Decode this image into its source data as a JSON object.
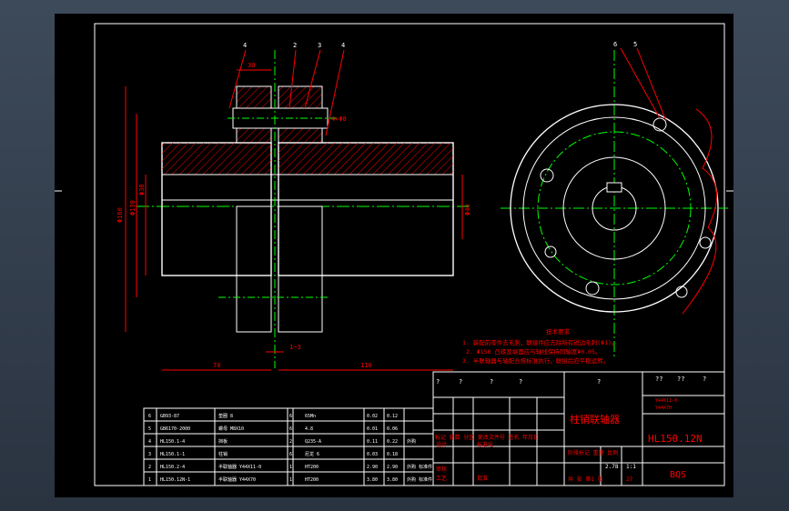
{
  "title_block": {
    "drawing_name": "柱销联轴器",
    "drawing_number": "HL150.12N",
    "school": "BQS",
    "top_qmarks": [
      "?",
      "?",
      "?",
      "?",
      "?",
      "??",
      "??",
      "?"
    ],
    "spec_line1": "Y44X11-0",
    "spec_line2": "Y44X70",
    "rev_header": "标记 处数 分区 更改文件号 签名 年月日",
    "designer": "设计",
    "standardize": "标准化",
    "check": "审核",
    "process": "工艺",
    "approve": "批准",
    "stage_header": "阶段标记 重量 比例",
    "weight": "2.78",
    "scale": "1:1",
    "sheets": "共 张 第1 张",
    "sheet_no": "27"
  },
  "tech_requirements": {
    "title": "技术要求",
    "lines": [
      "1. 装配前零件去毛刺，联接件应去除所有锐边毛刺(Φ1)。",
      "2. Φ150 凸缘及端面应与轴线保持同轴度Φ0.05。",
      "3. 半联轴器与轴配合按标准执行，联接后应平稳运转。"
    ]
  },
  "bom": [
    {
      "no": "6",
      "code": "GB93-87",
      "name": "垫圈 8",
      "qty": "6",
      "material": "65Mn",
      "unit": "0.02",
      "total": "0.12",
      "note": ""
    },
    {
      "no": "5",
      "code": "GB6170-2000",
      "name": "螺母 M8X10",
      "qty": "6",
      "material": "4.8",
      "unit": "0.01",
      "total": "0.06",
      "note": ""
    },
    {
      "no": "4",
      "code": "HL150.1-4",
      "name": "挡板",
      "qty": "2",
      "material": "Q235-A",
      "unit": "0.11",
      "total": "0.22",
      "note": "外购"
    },
    {
      "no": "3",
      "code": "HL150.1-1",
      "name": "柱销",
      "qty": "6",
      "material": "尼龙 6",
      "unit": "0.03",
      "total": "0.18",
      "note": ""
    },
    {
      "no": "2",
      "code": "HL150.2-4",
      "name": "半联轴器 Y44X11-0",
      "qty": "1",
      "material": "HT200",
      "unit": "2.90",
      "total": "2.90",
      "note": "外购 标准件"
    },
    {
      "no": "1",
      "code": "HL150.12N-1",
      "name": "半联轴器 Y44X70",
      "qty": "1",
      "material": "HT200",
      "unit": "3.80",
      "total": "3.80",
      "note": "外购 标准件"
    }
  ],
  "dimensions": {
    "d1": "Φ160",
    "d2": "Φ130",
    "d3": "Φ38",
    "d4": "Φ40",
    "w_left": "70",
    "w_right": "110",
    "gap": "1~3",
    "w_top": "30",
    "side": "4×Φ8"
  },
  "part_balloons": [
    "4",
    "2",
    "3",
    "4",
    "6",
    "5"
  ]
}
